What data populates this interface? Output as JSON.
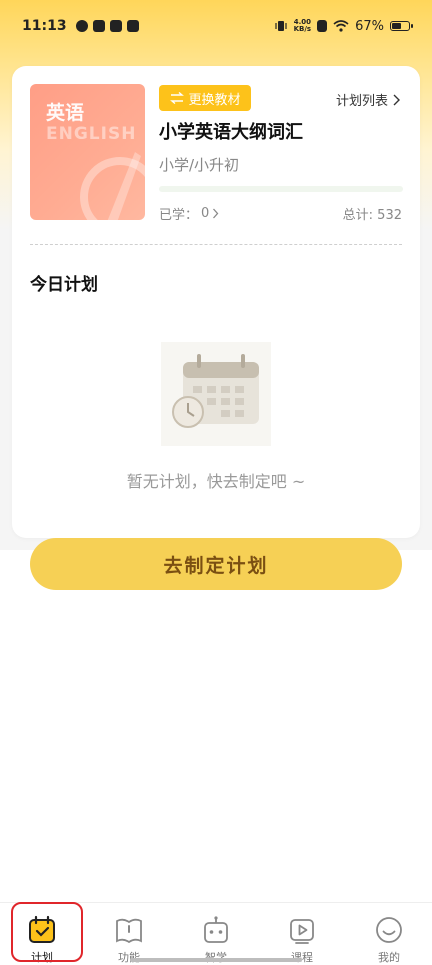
{
  "status_bar": {
    "time": "11:13",
    "net_speed_value": "4.00",
    "net_speed_unit": "KB/s",
    "battery": "67%",
    "battery_level": 0.67
  },
  "course": {
    "book_cover_title": "英语",
    "book_cover_subtitle": "ENGLISH",
    "change_button": "更换教材",
    "plan_list_link": "计划列表",
    "title": "小学英语大纲词汇",
    "level": "小学/小升初",
    "learned_label": "已学：",
    "learned_count": "0",
    "total_label": "总计: ",
    "total_count": "532",
    "progress": 0
  },
  "today": {
    "title": "今日计划",
    "empty_text": "暂无计划，快去制定吧 ~"
  },
  "action": {
    "make_plan": "去制定计划"
  },
  "tabbar": {
    "items": [
      {
        "label": "计划",
        "icon": "calendar-icon",
        "active": true
      },
      {
        "label": "功能",
        "icon": "book-icon",
        "active": false
      },
      {
        "label": "智学",
        "icon": "robot-icon",
        "active": false
      },
      {
        "label": "课程",
        "icon": "play-icon",
        "active": false
      },
      {
        "label": "我的",
        "icon": "smile-icon",
        "active": false
      }
    ]
  },
  "colors": {
    "accent_yellow": "#FDC21A",
    "button_yellow": "#F6D055",
    "button_text": "#7A4F12",
    "progress_green": "#8BD46E",
    "highlight_red": "#E0262B"
  }
}
